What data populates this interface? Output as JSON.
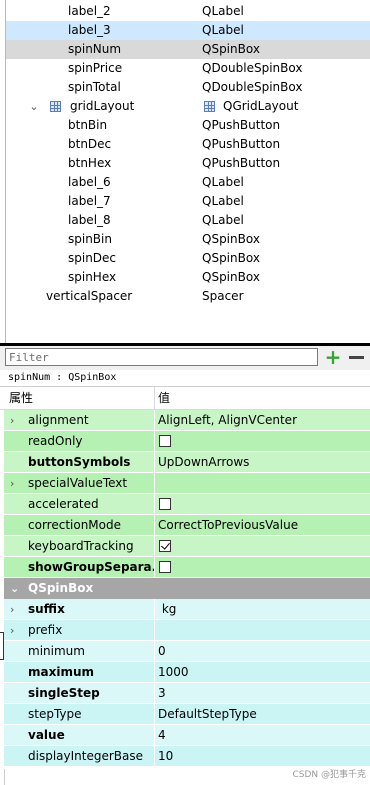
{
  "tree": {
    "rows": [
      {
        "name": "label_2",
        "class": "QLabel",
        "indent": 2,
        "state": "",
        "icon": false,
        "expander": ""
      },
      {
        "name": "label_3",
        "class": "QLabel",
        "indent": 2,
        "state": "sel",
        "icon": false,
        "expander": ""
      },
      {
        "name": "spinNum",
        "class": "QSpinBox",
        "indent": 2,
        "state": "cur",
        "icon": false,
        "expander": ""
      },
      {
        "name": "spinPrice",
        "class": "QDoubleSpinBox",
        "indent": 2,
        "state": "",
        "icon": false,
        "expander": ""
      },
      {
        "name": "spinTotal",
        "class": "QDoubleSpinBox",
        "indent": 2,
        "state": "",
        "icon": false,
        "expander": ""
      },
      {
        "name": "gridLayout",
        "class": "QGridLayout",
        "indent": 1,
        "state": "",
        "icon": true,
        "expander": "⌄"
      },
      {
        "name": "btnBin",
        "class": "QPushButton",
        "indent": 2,
        "state": "",
        "icon": false,
        "expander": ""
      },
      {
        "name": "btnDec",
        "class": "QPushButton",
        "indent": 2,
        "state": "",
        "icon": false,
        "expander": ""
      },
      {
        "name": "btnHex",
        "class": "QPushButton",
        "indent": 2,
        "state": "",
        "icon": false,
        "expander": ""
      },
      {
        "name": "label_6",
        "class": "QLabel",
        "indent": 2,
        "state": "",
        "icon": false,
        "expander": ""
      },
      {
        "name": "label_7",
        "class": "QLabel",
        "indent": 2,
        "state": "",
        "icon": false,
        "expander": ""
      },
      {
        "name": "label_8",
        "class": "QLabel",
        "indent": 2,
        "state": "",
        "icon": false,
        "expander": ""
      },
      {
        "name": "spinBin",
        "class": "QSpinBox",
        "indent": 2,
        "state": "",
        "icon": false,
        "expander": ""
      },
      {
        "name": "spinDec",
        "class": "QSpinBox",
        "indent": 2,
        "state": "",
        "icon": false,
        "expander": ""
      },
      {
        "name": "spinHex",
        "class": "QSpinBox",
        "indent": 2,
        "state": "",
        "icon": false,
        "expander": ""
      },
      {
        "name": "verticalSpacer",
        "class": "Spacer",
        "indent": 0,
        "state": "",
        "icon": false,
        "expander": ""
      }
    ]
  },
  "filter": {
    "placeholder": "Filter",
    "add_icon": "plus-icon",
    "remove_icon": "minus-icon"
  },
  "object_label": "spinNum : QSpinBox",
  "header": {
    "property": "属性",
    "value": "值"
  },
  "properties": [
    {
      "kind": "prop",
      "name": "alignment",
      "value": "AlignLeft, AlignVCenter",
      "expandable": true,
      "bold": false,
      "color": "green",
      "checkbox": null
    },
    {
      "kind": "prop",
      "name": "readOnly",
      "value": "",
      "expandable": false,
      "bold": false,
      "color": "green",
      "checkbox": false
    },
    {
      "kind": "prop",
      "name": "buttonSymbols",
      "value": "UpDownArrows",
      "expandable": false,
      "bold": true,
      "color": "green",
      "checkbox": null
    },
    {
      "kind": "prop",
      "name": "specialValueText",
      "value": "",
      "expandable": true,
      "bold": false,
      "color": "green",
      "checkbox": null
    },
    {
      "kind": "prop",
      "name": "accelerated",
      "value": "",
      "expandable": false,
      "bold": false,
      "color": "green",
      "checkbox": false
    },
    {
      "kind": "prop",
      "name": "correctionMode",
      "value": "CorrectToPreviousValue",
      "expandable": false,
      "bold": false,
      "color": "green",
      "checkbox": null
    },
    {
      "kind": "prop",
      "name": "keyboardTracking",
      "value": "",
      "expandable": false,
      "bold": false,
      "color": "green",
      "checkbox": true
    },
    {
      "kind": "prop",
      "name": "showGroupSepara...",
      "value": "",
      "expandable": false,
      "bold": true,
      "color": "green",
      "checkbox": false
    },
    {
      "kind": "section",
      "name": "QSpinBox"
    },
    {
      "kind": "prop",
      "name": "suffix",
      "value": " kg",
      "expandable": true,
      "bold": true,
      "color": "cyan",
      "checkbox": null
    },
    {
      "kind": "prop",
      "name": "prefix",
      "value": "",
      "expandable": true,
      "bold": false,
      "color": "cyan",
      "checkbox": null
    },
    {
      "kind": "prop",
      "name": "minimum",
      "value": "0",
      "expandable": false,
      "bold": false,
      "color": "cyan",
      "checkbox": null
    },
    {
      "kind": "prop",
      "name": "maximum",
      "value": "1000",
      "expandable": false,
      "bold": true,
      "color": "cyan",
      "checkbox": null
    },
    {
      "kind": "prop",
      "name": "singleStep",
      "value": "3",
      "expandable": false,
      "bold": true,
      "color": "cyan",
      "checkbox": null
    },
    {
      "kind": "prop",
      "name": "stepType",
      "value": "DefaultStepType",
      "expandable": false,
      "bold": false,
      "color": "cyan",
      "checkbox": null
    },
    {
      "kind": "prop",
      "name": "value",
      "value": "4",
      "expandable": false,
      "bold": true,
      "color": "cyan",
      "checkbox": null
    },
    {
      "kind": "prop",
      "name": "displayIntegerBase",
      "value": "10",
      "expandable": false,
      "bold": false,
      "color": "cyan",
      "checkbox": null
    }
  ],
  "watermark": "CSDN @犯事千克",
  "colors": {
    "selection": "#cde8ff",
    "current_row": "#d9d9d9",
    "qabstractspinbox_group": "#c8f5c6",
    "qspinbox_group": "#cbf5f5",
    "section_header": "#a6a6a6"
  }
}
